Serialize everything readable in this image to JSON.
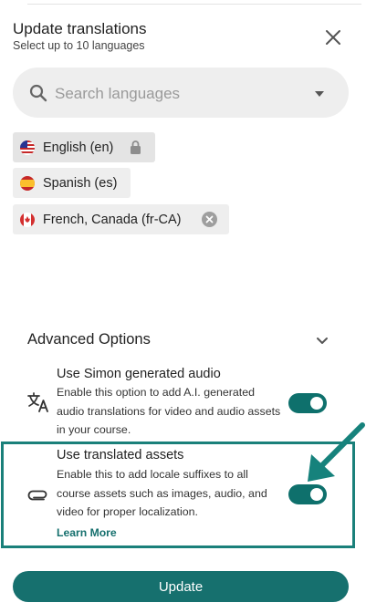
{
  "header": {
    "title": "Update translations",
    "subtitle": "Select up to 10 languages"
  },
  "search": {
    "placeholder": "Search languages",
    "value": ""
  },
  "languages": [
    {
      "label": "English (en)",
      "flag": "us-flag",
      "status": "locked",
      "trail_icon": "lock-icon"
    },
    {
      "label": "Spanish (es)",
      "flag": "spain-flag",
      "status": "selected",
      "trail_icon": ""
    },
    {
      "label": "French, Canada (fr-CA)",
      "flag": "canada-flag",
      "status": "removable",
      "trail_icon": "remove-icon"
    }
  ],
  "advanced": {
    "title": "Advanced Options",
    "expanded": true,
    "options": [
      {
        "icon": "translate-icon",
        "title": "Use Simon generated audio",
        "description": "Enable this option to add A.I. generated audio translations for video and audio assets in your course.",
        "enabled": true
      },
      {
        "icon": "paperclip-icon",
        "title": "Use translated assets",
        "description": "Enable this to add locale suffixes to all course assets such as images, audio, and video for proper localization.",
        "enabled": true,
        "link": "Learn More"
      }
    ]
  },
  "footer": {
    "update_label": "Update"
  },
  "colors": {
    "accent": "#16706e",
    "chip_bg": "#eeeeee",
    "highlight": "#1a807a"
  }
}
